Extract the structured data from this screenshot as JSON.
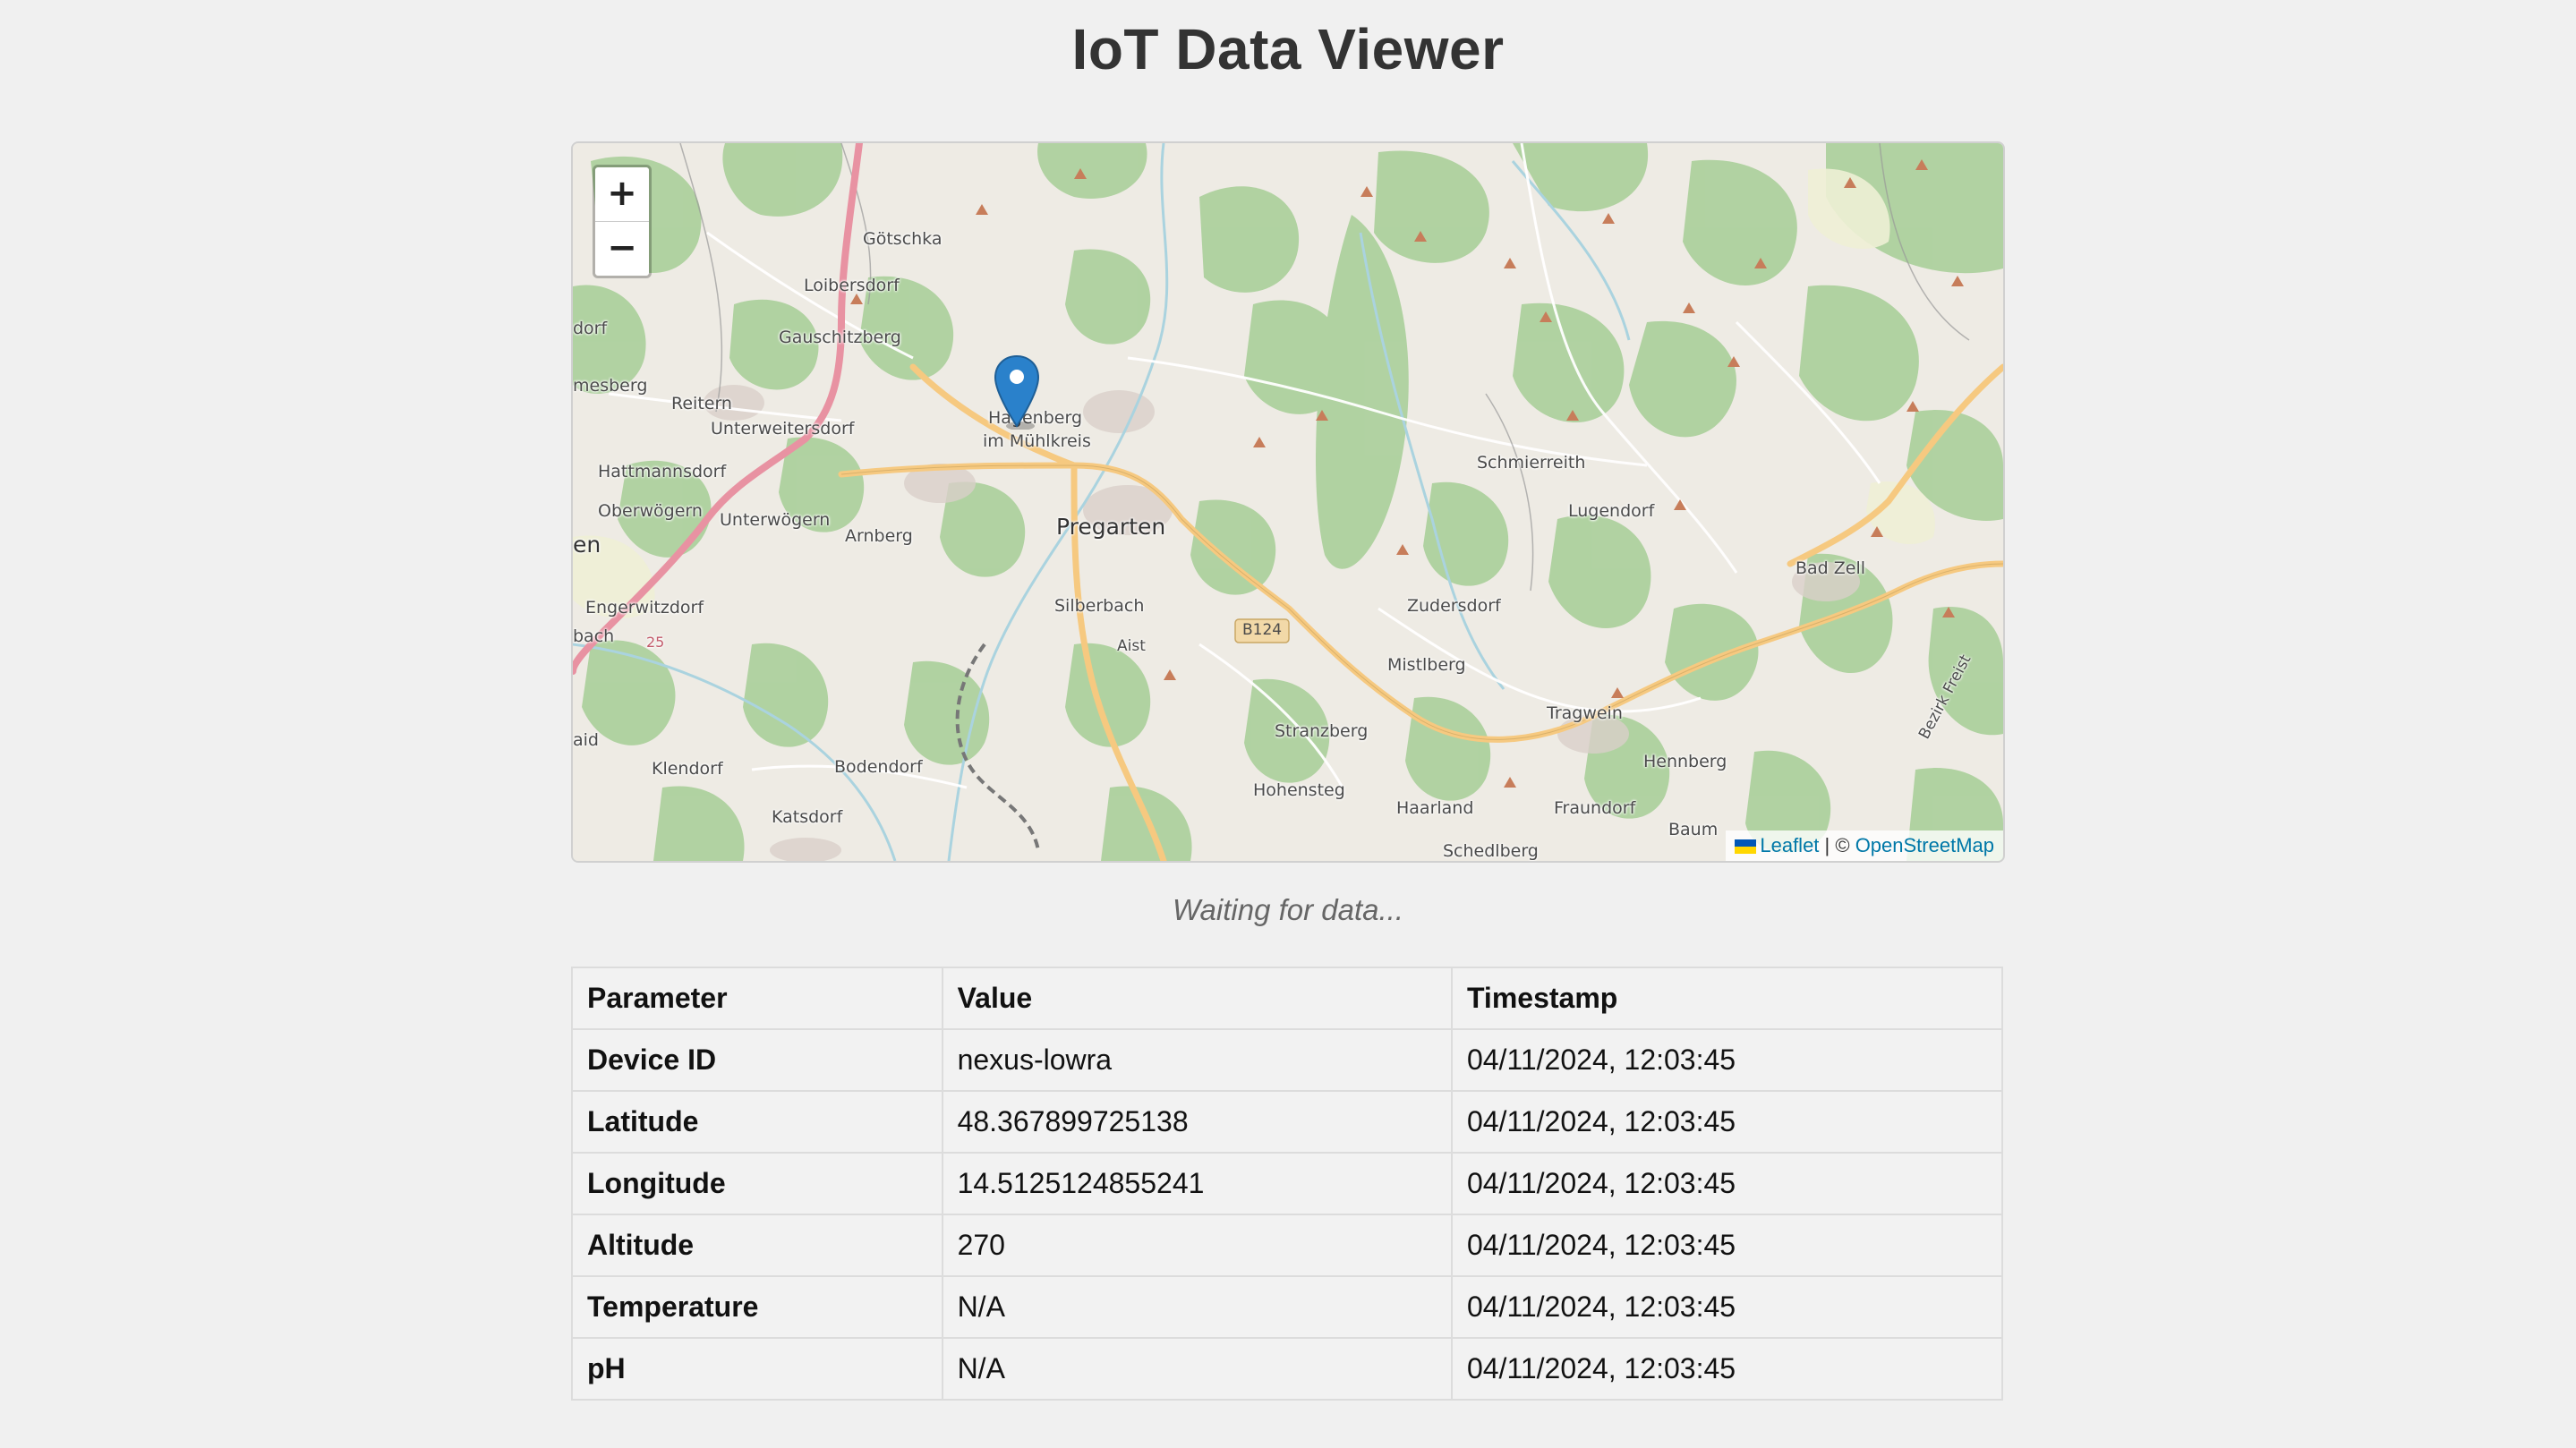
{
  "header": {
    "title": "IoT Data Viewer"
  },
  "map": {
    "zoom_in_label": "+",
    "zoom_out_label": "−",
    "marker_location": "Hagenberg im Mühlkreis",
    "places": {
      "goetschka": "Götschka",
      "loibersdorf": "Loibersdorf",
      "gauschitzberg": "Gauschitzberg",
      "reitern": "Reitern",
      "mesberg": "mesberg",
      "dorf": "dorf",
      "unterweitersdorf": "Unterweitersdorf",
      "hagenberg1": "Hagenberg",
      "hagenberg2": "im Mühlkreis",
      "hattmannsdorf": "Hattmannsdorf",
      "oberwoegern": "Oberwögern",
      "unterwoegern": "Unterwögern",
      "arnberg": "Arnberg",
      "pregarten": "Pregarten",
      "en": "en",
      "engerwitzdorf": "Engerwitzdorf",
      "bach": "bach",
      "silberbach": "Silberbach",
      "aist": "Aist",
      "b124": "B124",
      "road25": "25",
      "schmierreith": "Schmierreith",
      "lugendorf": "Lugendorf",
      "badzell": "Bad Zell",
      "zudersdorf": "Zudersdorf",
      "mistlberg": "Mistlberg",
      "tragwein": "Tragwein",
      "stranzberg": "Stranzberg",
      "hennberg": "Hennberg",
      "aid": "aid",
      "klendorf": "Klendorf",
      "bodendorf": "Bodendorf",
      "katsdorf": "Katsdorf",
      "hohensteg": "Hohensteg",
      "haarland": "Haarland",
      "fraundorf": "Fraundorf",
      "baum": "Baum",
      "schedlberg": "Schedlberg",
      "bezirk": "Bezirk Freist"
    },
    "attribution": {
      "leaflet": "Leaflet",
      "separator": " | © ",
      "osm": "OpenStreetMap"
    }
  },
  "status": {
    "text": "Waiting for data..."
  },
  "table": {
    "headers": [
      "Parameter",
      "Value",
      "Timestamp"
    ],
    "rows": [
      {
        "parameter": "Device ID",
        "value": "nexus-lowra",
        "timestamp": "04/11/2024, 12:03:45"
      },
      {
        "parameter": "Latitude",
        "value": "48.367899725138",
        "timestamp": "04/11/2024, 12:03:45"
      },
      {
        "parameter": "Longitude",
        "value": "14.5125124855241",
        "timestamp": "04/11/2024, 12:03:45"
      },
      {
        "parameter": "Altitude",
        "value": "270",
        "timestamp": "04/11/2024, 12:03:45"
      },
      {
        "parameter": "Temperature",
        "value": "N/A",
        "timestamp": "04/11/2024, 12:03:45"
      },
      {
        "parameter": "pH",
        "value": "N/A",
        "timestamp": "04/11/2024, 12:03:45"
      }
    ]
  },
  "colors": {
    "background": "#f0f0f0",
    "map_land": "#eeebe4",
    "map_forest": "#add19e",
    "road_major": "#f6c980",
    "road_highway": "#e892a2",
    "marker": "#2a81cb",
    "link": "#0078a8"
  }
}
